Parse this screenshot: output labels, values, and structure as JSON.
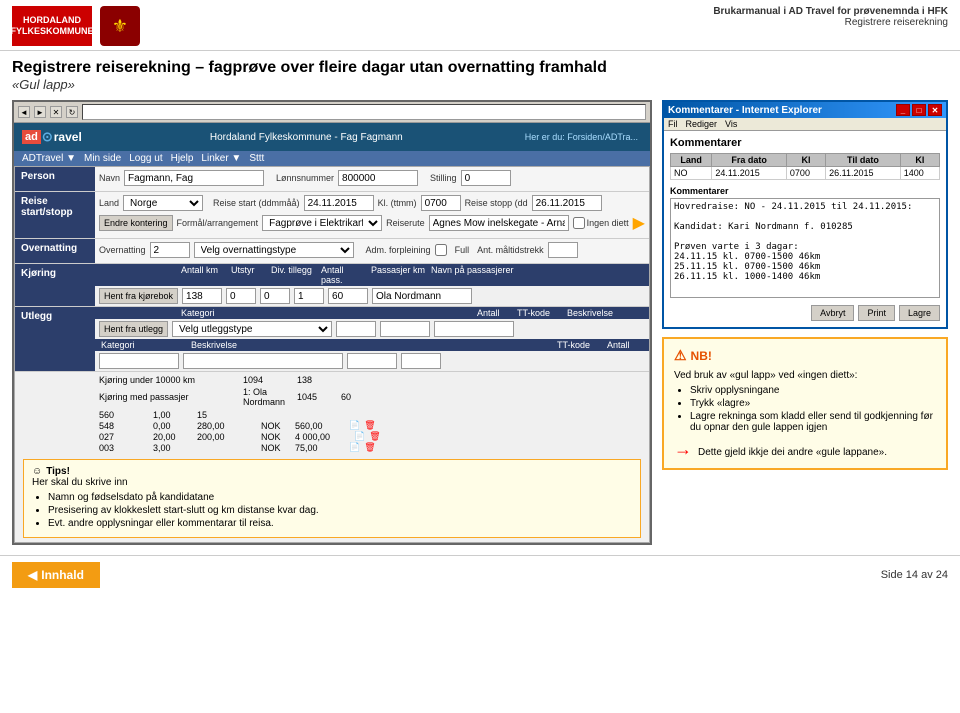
{
  "header": {
    "org_logo_text": "HORDALAND FYLKESKOMMUNE",
    "doc_title": "Brukarmanual i AD Travel for prøvenemnda i HFK",
    "doc_subtitle": "Registrere reiserekning"
  },
  "page": {
    "title": "Registrere reiserekning – fagprøve over fleire dagar utan overnatting framhald",
    "subtitle": "«Gul lapp»"
  },
  "browser": {
    "nav": {
      "logo_ad": "ad",
      "logo_travel": "Travel",
      "company": "Hordaland Fylkeskommune - Fag Fagmann",
      "her_du": "Her er du: Forsiden/ADTra...",
      "links": [
        "ADTravel",
        "Min side",
        "Logg ut",
        "Hjelp",
        "Linker",
        "Sttt"
      ]
    },
    "person": {
      "label": "Person",
      "navn_label": "Navn",
      "navn_value": "Fagmann, Fag",
      "lonnsnr_label": "Lønnsnummer",
      "lonnsnr_value": "800000",
      "stilling_label": "Stilling",
      "stilling_value": "0"
    },
    "reise_start": {
      "label": "Reise start/stopp",
      "land_label": "Land",
      "land_value": "Norge",
      "reise_start_label": "Reise start (ddmmåå)",
      "reise_start_value": "24.11.2015",
      "kl_label": "Kl. (ttmm)",
      "kl_value": "0700",
      "reise_stopp_label": "Reise stopp (dd",
      "reise_stopp_value": "26.11.2015",
      "formal_label": "Formål/arrangement",
      "formal_value": "Fagprøve i Elektrikarfaget",
      "reiserute_label": "Reiserute",
      "reiserute_value": "Agnes Mow inelskegate - Arna t/r",
      "ingen_diett_label": "Ingen diett",
      "endre_kontering_btn": "Endre kontering"
    },
    "overnatting": {
      "label": "Overnatting",
      "overnatting_label": "Overnatting",
      "overnatting_value": "2",
      "type_label": "Velg overnattingstype",
      "adm_forpleining_label": "Adm. forpleining",
      "full_label": "Full",
      "ant_maltidstrekk_label": "Ant. måltidstrekk"
    },
    "kjoring": {
      "label": "Kjøring",
      "hent_btn": "Hent fra kjørebok",
      "antall_km_label": "Antall km",
      "antall_km_value": "138",
      "utstyr_label": "Utstyr",
      "utstyr_value": "0",
      "div_tillegg_label": "Div. tillegg",
      "div_tillegg_value": "0",
      "antall_pass_label": "Antall pass.",
      "antall_pass_value": "1",
      "passasjer_km_label": "Passasjer km",
      "passasjer_km_value": "60",
      "navn_passasjer_label": "Navn på passasjerer",
      "navn_passasjer_value": "Ola Nordmann"
    },
    "utlegg": {
      "label": "Utlegg",
      "hent_btn": "Hent fra utlegg",
      "kategori_label": "Kategori",
      "kategori_value": "Velg utleggstype",
      "tt_kode_label": "TT-kode",
      "beskrivelse_label": "Beskrivelse",
      "antall_label": "Antall",
      "row2_kategori_label": "Kategori",
      "row2_beskrivelse_label": "Beskrivelse",
      "row2_tt_kode_label": "TT-kode",
      "row2_antall_label": "Antall"
    },
    "summary": {
      "rows": [
        {
          "label": "Kjøring under 10000 km",
          "km": "1094",
          "val": "138"
        },
        {
          "label": "Kjøring med passasjer",
          "num": "1: Ola Nordmann",
          "km": "1045",
          "val": "60"
        }
      ],
      "utlegg_rows": [
        {
          "km": "560",
          "rate": "1,00",
          "nok1": "15"
        },
        {
          "km": "548",
          "rate": "0,00",
          "nok1": "280,00",
          "nok2": "NOK",
          "nok3": "560,00",
          "icon": "📄"
        },
        {
          "km": "027",
          "rate": "20,00",
          "nok1": "200,00",
          "nok2": "NOK",
          "nok3": "4 000,00",
          "icon": "📄"
        },
        {
          "km": "003",
          "rate": "3,00",
          "nok1": "",
          "nok2": "NOK",
          "nok3": "75,00",
          "icon": "📄"
        }
      ]
    },
    "tips": {
      "title": "Tips!",
      "intro": "Her skal du skrive inn",
      "items": [
        "Namn og fødselsdato på kandidatane",
        "Presisering av klokkeslett start-slutt og km distanse kvar dag.",
        "Evt. andre opplysningar eller kommentarar til reisa."
      ]
    }
  },
  "kommentarer_window": {
    "title": "Kommentarer",
    "ie_title": "Kommentarer - Internet Explorer",
    "table_headers": [
      "Land",
      "Fra dato",
      "Kl",
      "Til dato",
      "Kl"
    ],
    "table_row": [
      "NO",
      "24.11.2015",
      "0700",
      "26.11.2015",
      "1400"
    ],
    "content_label": "Kommentarer",
    "content_text": "Hovredraise: NO - 24.11.2015 til 24.11.2015:\n\nKandidat: Kari Nordmann f. 010285\n\nPrøven varte i 3 dagar:\n24.11.15 kl. 0700-1500 46km\n25.11.15 kl. 0700-1500 46km\n26.11.15 kl. 1000-1400 46km",
    "buttons": [
      "Avbryt",
      "Print",
      "Lagre"
    ]
  },
  "nb_box": {
    "title": "NB!",
    "intro": "Ved bruk av «gul lapp» ved «ingen diett»:",
    "items": [
      "Skriv opplysningane",
      "Trykk «lagre»",
      "Lagre rekninga som kladd eller send til godkjenning før du opnar den gule lappen igjen"
    ],
    "footer": "Dette gjeld ikkje dei andre «gule lappane»."
  },
  "bottom": {
    "innhald_btn": "Innhald",
    "page_label": "Side 14 av 24"
  }
}
